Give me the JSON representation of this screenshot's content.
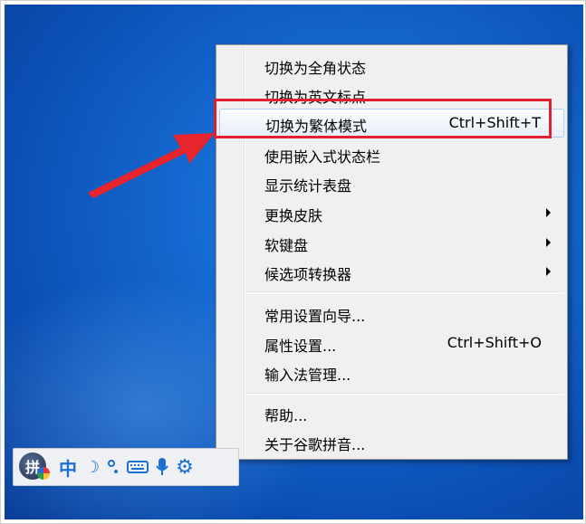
{
  "menu": {
    "items": [
      {
        "label": "切换为全角状态",
        "shortcut": ""
      },
      {
        "label": "切换为英文标点",
        "shortcut": ""
      },
      {
        "label": "切换为繁体模式",
        "shortcut": "Ctrl+Shift+T",
        "highlighted": true
      },
      {
        "label": "使用嵌入式状态栏",
        "shortcut": ""
      },
      {
        "label": "显示统计表盘",
        "shortcut": ""
      },
      {
        "label": "更换皮肤",
        "submenu": true
      },
      {
        "label": "软键盘",
        "submenu": true
      },
      {
        "label": "候选项转换器",
        "submenu": true
      },
      {
        "label": "常用设置向导...",
        "shortcut": ""
      },
      {
        "label": "属性设置...",
        "shortcut": "Ctrl+Shift+O"
      },
      {
        "label": "输入法管理...",
        "shortcut": ""
      },
      {
        "label": "帮助...",
        "shortcut": ""
      },
      {
        "label": "关于谷歌拼音...",
        "shortcut": ""
      }
    ]
  },
  "toolbar": {
    "logo_char": "拼",
    "mode_label": "中",
    "width_icon": "half-moon-icon",
    "punct_icon": "punctuation-icon",
    "keyboard_icon": "keyboard-icon",
    "mic_icon": "microphone-icon",
    "settings_icon": "gear-icon"
  },
  "colors": {
    "highlight_box": "#e02030",
    "toolbar_icon": "#1a6fd1",
    "desktop": "#1468cf"
  }
}
